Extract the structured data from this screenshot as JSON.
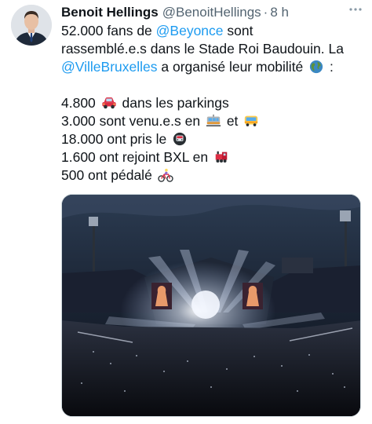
{
  "author": {
    "name": "Benoit Hellings",
    "handle": "@BenoitHellings",
    "separator": "·",
    "time": "8 h"
  },
  "tweet": {
    "line1_a": "52.000 fans de ",
    "line1_link": "@Beyonce",
    "line1_b": " sont",
    "line2": "rassemblé.e.s dans le Stade Roi Baudouin. La",
    "line3_link": "@VilleBruxelles",
    "line3_b": " a organisé leur mobilité",
    "line3_c": " :",
    "stats": {
      "parkings_a": "4.800",
      "parkings_b": "dans les parkings",
      "transit_a": "3.000 sont venu.e.s en",
      "transit_b": "et",
      "metro_a": "18.000 ont pris le",
      "train_a": "1.600 ont rejoint BXL en",
      "bike_a": "500 ont pédalé"
    }
  },
  "icons": {
    "more": "more-options-icon",
    "globe": "globe-emoji",
    "car": "car-emoji",
    "tram": "tram-emoji",
    "bus": "bus-emoji",
    "metro": "metro-emoji",
    "train": "train-emoji",
    "bike": "cyclist-emoji"
  },
  "colors": {
    "link": "#1d9bf0",
    "text": "#0f1419",
    "muted": "#536471"
  }
}
